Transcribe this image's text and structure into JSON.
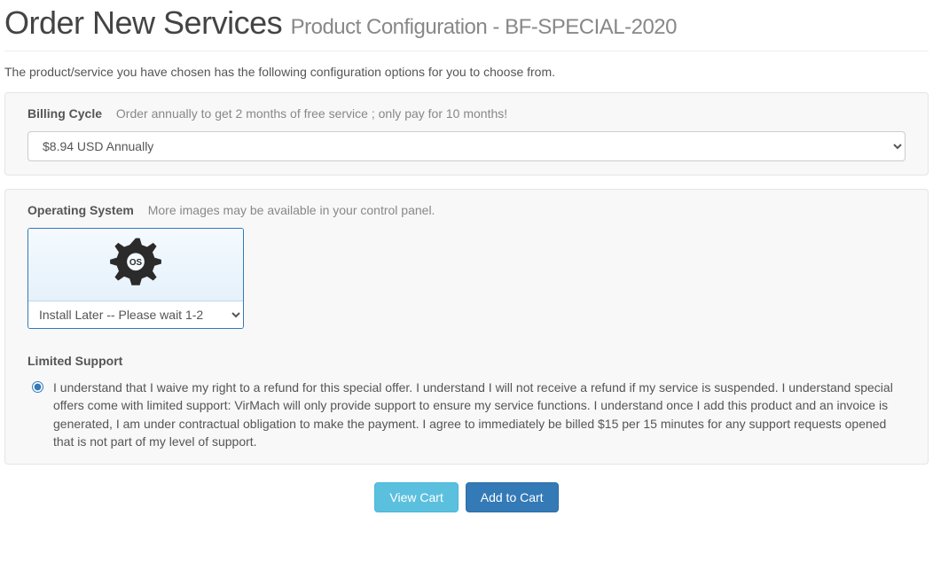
{
  "page": {
    "title": "Order New Services",
    "subtitle": "Product Configuration - BF-SPECIAL-2020",
    "intro": "The product/service you have chosen has the following configuration options for you to choose from."
  },
  "billing": {
    "label": "Billing Cycle",
    "hint": "Order annually to get 2 months of free service ; only pay for 10 months!",
    "selected": "$8.94 USD Annually"
  },
  "os": {
    "label": "Operating System",
    "hint": "More images may be available in your control panel.",
    "icon_text": "OS",
    "selected": "Install Later -- Please wait 1-2"
  },
  "support": {
    "label": "Limited Support",
    "agreement": "I understand that I waive my right to a refund for this special offer. I understand I will not receive a refund if my service is suspended. I understand special offers come with limited support: VirMach will only provide support to ensure my service functions. I understand once I add this product and an invoice is generated, I am under contractual obligation to make the payment. I agree to immediately be billed $15 per 15 minutes for any support requests opened that is not part of my level of support."
  },
  "actions": {
    "view_cart": "View Cart",
    "add_to_cart": "Add to Cart"
  }
}
